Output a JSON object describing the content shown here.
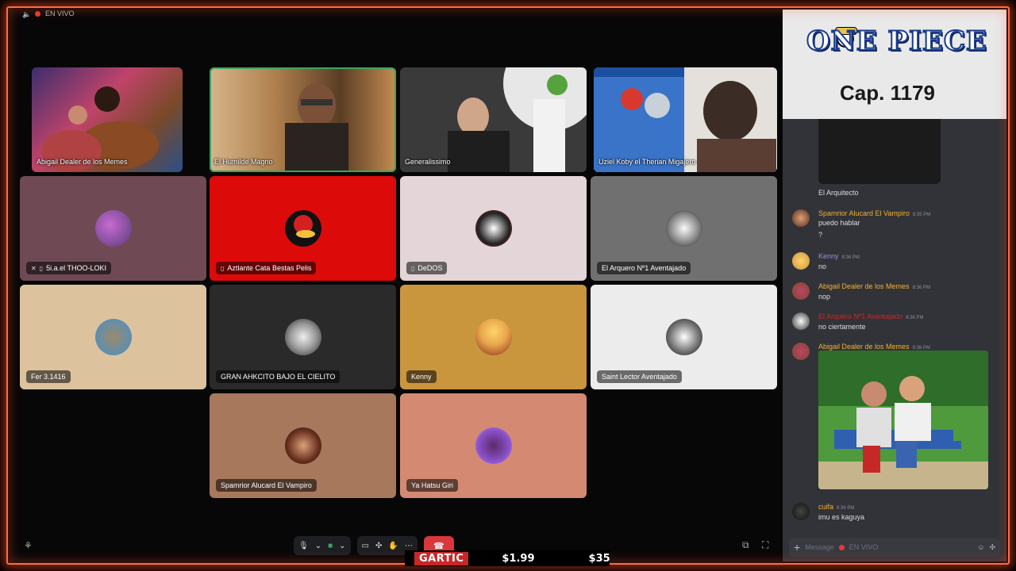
{
  "topbar": {
    "live_label": "EN VIVO"
  },
  "video_tiles": [
    {
      "name": "Abigail Dealer de los Memes"
    },
    {
      "name": "El Humilde Magno"
    },
    {
      "name": "Generalissimo"
    },
    {
      "name": "Uziel Koby el Therian Migajero"
    }
  ],
  "participants": [
    {
      "name": "5i.a.el THOO-LOKI",
      "color": "#6f4a55"
    },
    {
      "name": "Aztlante Cata Bestas Pelis",
      "color": "#dd0a0a"
    },
    {
      "name": "DeDOS",
      "color": "#e3d5d8"
    },
    {
      "name": "El Arquero Nº1 Aventajado",
      "color": "#707070"
    },
    {
      "name": "Fer 3.1416",
      "color": "#dcc39d"
    },
    {
      "name": "GRAN AHKCITO BAJO EL CIELITO",
      "color": "#2a2a2a"
    },
    {
      "name": "Kenny",
      "color": "#c9963e"
    },
    {
      "name": "Saint Lector Aventajado",
      "color": "#ececec"
    },
    {
      "name": "Spamrior Alucard El Vampiro",
      "color": "#a8785c"
    },
    {
      "name": "Ya Hatsu Giri",
      "color": "#d48a72"
    }
  ],
  "logo": {
    "title": "ONE PIECE",
    "chapter": "Cap. 1179"
  },
  "chat": {
    "prev_caption": "El Arquitecto",
    "messages": [
      {
        "author": "Spamrior Alucard El Vampiro",
        "time": "8:35 PM",
        "lines": [
          "puedo hablar",
          "?"
        ],
        "color": "#f0b232"
      },
      {
        "author": "Kenny",
        "time": "8:36 PM",
        "lines": [
          "no"
        ],
        "color": "#a38bd8"
      },
      {
        "author": "Abigail Dealer de los Memes",
        "time": "8:36 PM",
        "lines": [
          "nop"
        ],
        "color": "#f0b232"
      },
      {
        "author": "El Arquero Nº1 Aventajado",
        "time": "8:36 PM",
        "lines": [
          "no ciertamente"
        ],
        "color": "#c62828"
      },
      {
        "author": "Abigail Dealer de los Memes",
        "time": "8:36 PM",
        "lines": [],
        "color": "#f0b232"
      },
      {
        "author": "cuifa",
        "time": "8:36 PM",
        "lines": [
          "imu es kaguya"
        ],
        "color": "#f0b232"
      }
    ],
    "composer_placeholder": "Message",
    "composer_live": "EN VIVO"
  },
  "ticker": {
    "game": "GARTIC",
    "price1": "$1.99",
    "price2": "$35"
  }
}
